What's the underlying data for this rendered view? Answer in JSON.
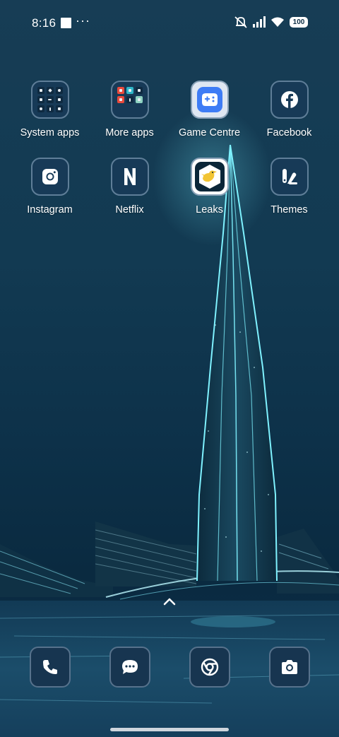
{
  "status_bar": {
    "time": "8:16",
    "more_indicator": "···",
    "battery_level": "100",
    "icons": [
      "notification-square-icon",
      "mute-vibrate-icon",
      "cellular-signal-icon",
      "wifi-icon",
      "battery-icon"
    ]
  },
  "apps": [
    {
      "label": "System apps",
      "icon": "system-apps-folder-icon"
    },
    {
      "label": "More apps",
      "icon": "more-apps-folder-icon"
    },
    {
      "label": "Game Centre",
      "icon": "game-controller-icon"
    },
    {
      "label": "Facebook",
      "icon": "facebook-icon"
    },
    {
      "label": "Instagram",
      "icon": "instagram-icon"
    },
    {
      "label": "Netflix",
      "icon": "netflix-icon"
    },
    {
      "label": "Leaks",
      "icon": "leaks-bird-icon"
    },
    {
      "label": "Themes",
      "icon": "themes-icon"
    }
  ],
  "dock": [
    {
      "icon": "phone-icon"
    },
    {
      "icon": "messages-icon"
    },
    {
      "icon": "chrome-icon"
    },
    {
      "icon": "camera-icon"
    }
  ],
  "colors": {
    "icon_tile": "#173a57",
    "icon_border": "#5f7e98",
    "accent_glow": "#6ff2ff",
    "game_centre_blue": "#3e7cf5",
    "leaks_yellow": "#f2c433"
  }
}
